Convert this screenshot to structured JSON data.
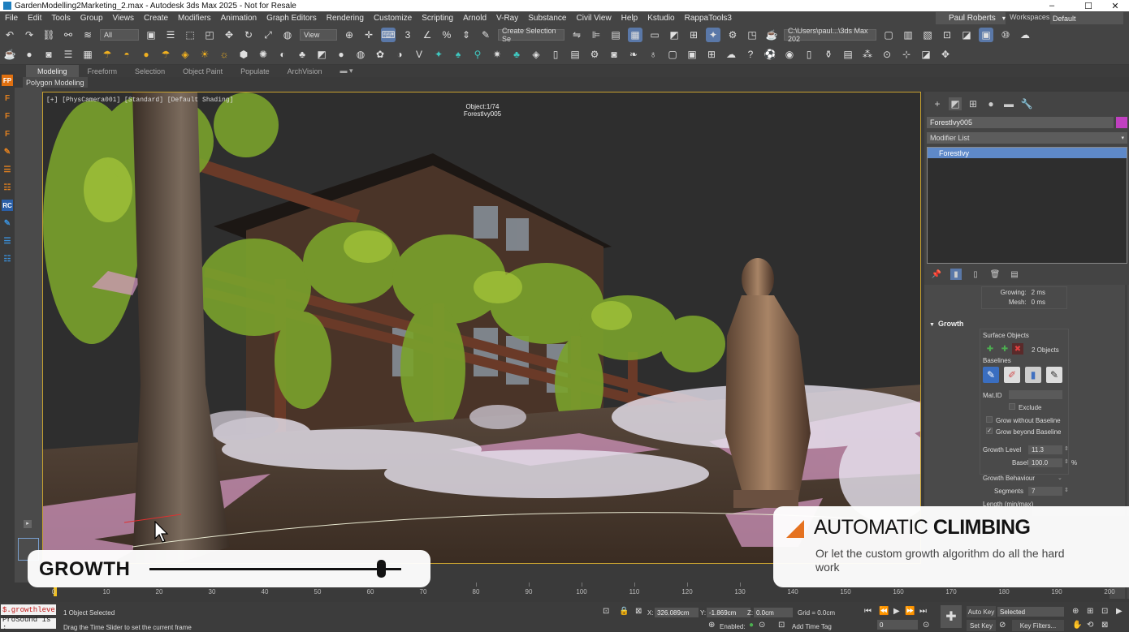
{
  "window": {
    "title": "GardenModelling2Marketing_2.max - Autodesk 3ds Max 2025 - Not for Resale",
    "controls": [
      "–",
      "☐",
      "✕"
    ]
  },
  "menu": [
    "File",
    "Edit",
    "Tools",
    "Group",
    "Views",
    "Create",
    "Modifiers",
    "Animation",
    "Graph Editors",
    "Rendering",
    "Customize",
    "Scripting",
    "Arnold",
    "V-Ray",
    "Substance",
    "Civil View",
    "Help",
    "Kstudio",
    "RappaTools3"
  ],
  "user": {
    "name": "Paul Roberts",
    "workspaces_label": "Workspaces:",
    "workspace": "Default"
  },
  "toolbar": {
    "filter": "All",
    "view": "View",
    "selection_set": "Create Selection Se",
    "path": "C:\\Users\\paul...\\3ds Max 202"
  },
  "ribbon": {
    "tabs": [
      "Modeling",
      "Freeform",
      "Selection",
      "Object Paint",
      "Populate",
      "ArchVision"
    ],
    "sub": "Polygon Modeling"
  },
  "left_strip": [
    "FP",
    "F",
    "F",
    "F",
    "✎",
    "☰",
    "☷",
    "RC",
    "✎",
    "☰",
    "☷"
  ],
  "viewport": {
    "label": "[+] [PhysCamera001] [Standard] [Default Shading]",
    "object_count": "Object:1/74",
    "object_name": "ForestIvy005"
  },
  "command_panel": {
    "object_name": "ForestIvy005",
    "object_color": "#c040c0",
    "modifier_list": "Modifier List",
    "stack": [
      "ForestIvy"
    ],
    "timing": [
      {
        "k": "Growing:",
        "v": "2 ms"
      },
      {
        "k": "Mesh:",
        "v": "0 ms"
      }
    ],
    "growth": {
      "title": "Growth",
      "surface_objects": "Surface Objects",
      "objects_count": "2 Objects",
      "baselines": "Baselines",
      "mat_id": "Mat.ID",
      "exclude": "Exclude",
      "grow_without_baseline": "Grow without Baseline",
      "grow_beyond_baseline": "Grow beyond Baseline",
      "growth_level_label": "Growth Level",
      "growth_level": "11.3",
      "baseline_label": "Baseline",
      "baseline": "100.0",
      "baseline_unit": "%",
      "growth_behaviour": "Growth Behaviour",
      "segments_label": "Segments",
      "segments": "7",
      "length_label": "Length (min/max)"
    }
  },
  "timeline": {
    "ticks": [
      0,
      10,
      20,
      30,
      40,
      50,
      60,
      70,
      80,
      90,
      100,
      110,
      120,
      130,
      140,
      150,
      160,
      170,
      180,
      190,
      200
    ],
    "current": 0
  },
  "status": {
    "script_line1": "$.growthleve",
    "script_line2": "ProSound is :",
    "selected": "1 Object Selected",
    "hint": "Drag the Time Slider to set the current frame",
    "x_label": "X:",
    "x": "326.089cm",
    "y_label": "Y:",
    "y": "-1.869cm",
    "z_label": "Z:",
    "z": "0.0cm",
    "grid": "Grid = 0.0cm",
    "enabled_label": "Enabled:",
    "add_time_tag": "Add Time Tag",
    "auto_key": "Auto Key",
    "set_key": "Set Key",
    "selected_dropdown": "Selected",
    "key_filters": "Key Filters...",
    "frame": "0"
  },
  "overlays": {
    "growth_label": "GROWTH",
    "growth_slider": 0.92,
    "climb_headline_light": "AUTOMATIC",
    "climb_headline_bold": "CLIMBING",
    "climb_desc": "Or let the custom growth algorithm do all the hard work",
    "accent": "#e8721c"
  }
}
